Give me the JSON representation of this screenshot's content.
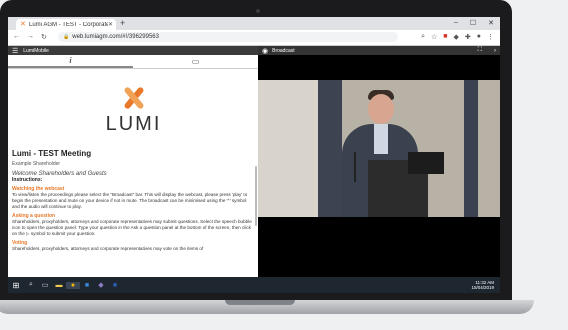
{
  "browser": {
    "tab_title": "Lumi AGM - TEST - Corporate Ba...",
    "url": "web.lumiagm.com/#!/396299563"
  },
  "left_panel": {
    "header_title": "LumiMobile",
    "tabs": [
      {
        "icon": "info-icon",
        "glyph": "i"
      },
      {
        "icon": "chat-icon",
        "glyph": "▭"
      }
    ],
    "logo_text": "LUMI",
    "meeting_title": "Lumi - TEST Meeting",
    "user_line": "Example Shareholder",
    "welcome": "Welcome Shareholders and Guests",
    "instructions_label": "Instructions:",
    "sections": [
      {
        "heading": "Watching the webcast",
        "text": "To view/listen the proceedings please select the \"Broadcast\" bar. This will display the webcast, please press 'play' to begin the presentation and mute on your device if not in mute. The broadcast can be minimised using the '^' symbol and the audio will continue to play."
      },
      {
        "heading": "Asking a question",
        "text": "Shareholders, proxyholders, attorneys and corporate representatives may submit questions. Select the speech bubble icon to open the question panel. Type your question in the Ask a question panel at the bottom of the screen, then click on the ▷ symbol to submit your question."
      },
      {
        "heading": "Voting",
        "text": "Shareholders, proxyholders, attorneys and corporate representatives may vote on the items of"
      }
    ]
  },
  "right_panel": {
    "header_title": "Broadcast"
  },
  "taskbar": {
    "time": "11:32 AM",
    "date": "15/04/2019"
  },
  "colors": {
    "accent": "#e8792a",
    "taskbar": "#1e2630"
  }
}
